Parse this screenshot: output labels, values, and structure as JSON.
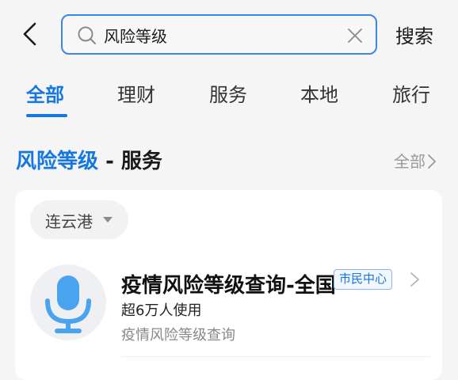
{
  "header": {
    "back_icon": "chevron-left-icon",
    "search": {
      "value": "风险等级",
      "placeholder": "",
      "icon": "search-icon",
      "clear_icon": "close-icon"
    },
    "search_button_label": "搜索"
  },
  "tabs": [
    {
      "label": "全部",
      "active": true
    },
    {
      "label": "理财",
      "active": false
    },
    {
      "label": "服务",
      "active": false
    },
    {
      "label": "本地",
      "active": false
    },
    {
      "label": "旅行",
      "active": false
    }
  ],
  "section": {
    "keyword": "风险等级",
    "separator": " - ",
    "category": "服务",
    "more_label": "全部"
  },
  "card": {
    "city": "连云港",
    "result": {
      "icon": "microphone-icon",
      "name": "疫情风险等级查询-全国",
      "badge": "市民中心",
      "users": "超6万人使用",
      "description": "疫情风险等级查询"
    }
  },
  "colors": {
    "accent": "#1677e0",
    "background": "#f5f5f5",
    "card": "#ffffff",
    "mic": "#4aa3ef"
  }
}
